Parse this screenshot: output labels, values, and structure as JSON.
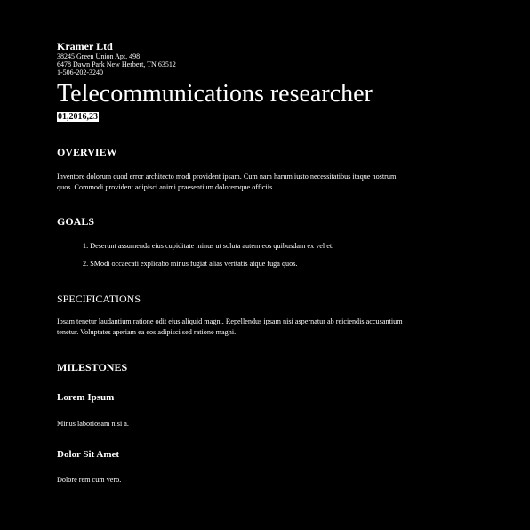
{
  "header": {
    "company": "Kramer Ltd",
    "address_line1": "38245 Green Union Apt. 498",
    "address_line2": "6478 Dawn Park New Herbert, TN 63512",
    "phone": "1-506-202-3240"
  },
  "title": "Telecommunications researcher",
  "date": "01,2016,23",
  "overview": {
    "heading": "OVERVIEW",
    "text": "Inventore dolorum quod error architecto modi provident ipsam. Cum nam harum iusto necessitatibus itaque nostrum quos. Commodi provident adipisci animi praesentium doloremque officiis."
  },
  "goals": {
    "heading": "GOALS",
    "items": [
      "1. Deserunt assumenda eius cupiditate minus ut soluta autem eos quibusdam ex vel et.",
      "2. SModi occaecati explicabo minus fugiat alias veritatis atque fuga quos."
    ]
  },
  "specifications": {
    "heading": "SPECIFICATIONS",
    "text": "Ipsam tenetur laudantium ratione odit eius aliquid magni. Repellendus ipsam nisi aspernatur ab reiciendis accusantium tenetur. Voluptates aperiam ea eos adipisci sed ratione magni."
  },
  "milestones": {
    "heading": "MILESTONES",
    "items": [
      {
        "title": "Lorem Ipsum",
        "text": "Minus laboriosam nisi a."
      },
      {
        "title": "Dolor Sit Amet",
        "text": "Dolore rem cum vero."
      }
    ]
  }
}
